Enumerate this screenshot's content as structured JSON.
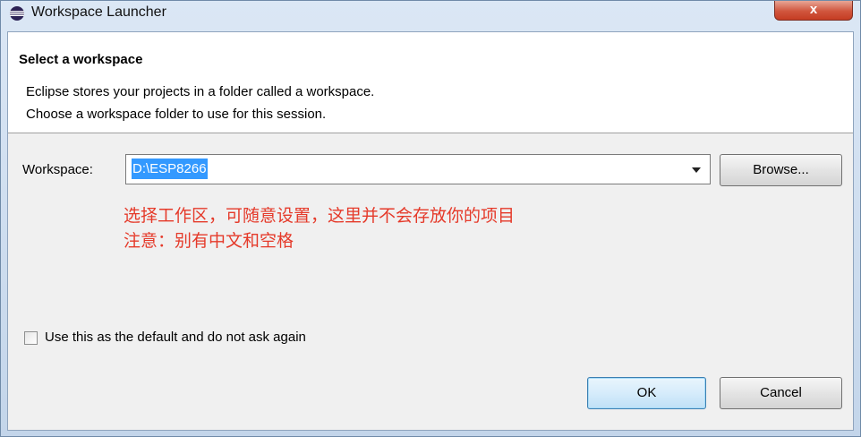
{
  "window": {
    "title": "Workspace Launcher",
    "close_label": "x"
  },
  "banner": {
    "title": "Select a workspace",
    "line1": "Eclipse stores your projects in a folder called a workspace.",
    "line2": "Choose a workspace folder to use for this session."
  },
  "workspace": {
    "label": "Workspace:",
    "value": "D:\\ESP8266",
    "browse_label": "Browse..."
  },
  "annotation": {
    "line1": "选择工作区，可随意设置，这里并不会存放你的项目",
    "line2": "注意：别有中文和空格",
    "color": "#e53a2a"
  },
  "default_checkbox": {
    "label": "Use this as the default and do not ask again",
    "checked": false
  },
  "buttons": {
    "ok": "OK",
    "cancel": "Cancel"
  },
  "icons": {
    "app": "eclipse-icon",
    "dropdown": "chevron-down-icon"
  }
}
